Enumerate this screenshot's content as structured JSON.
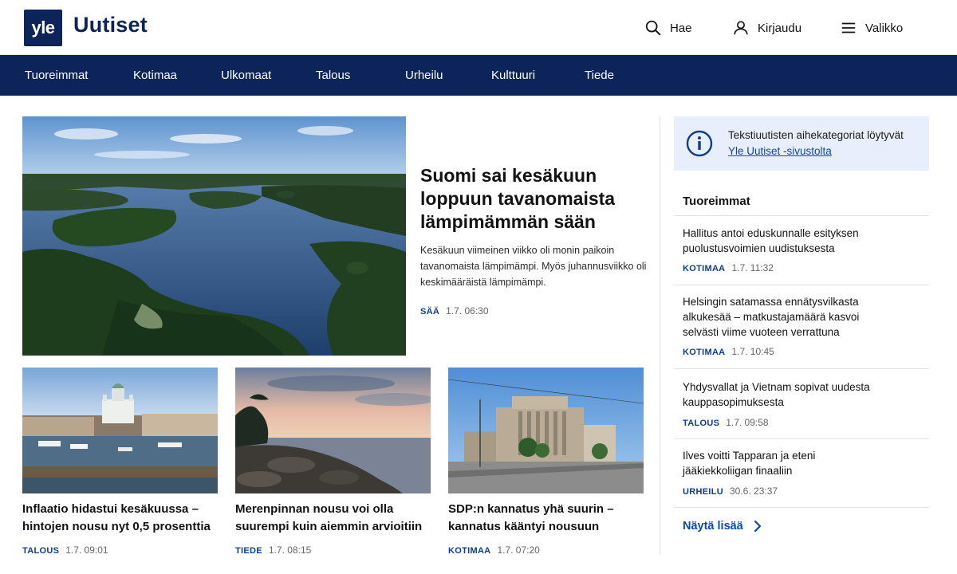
{
  "header": {
    "logo_text": "yle",
    "brand": "Uutiset",
    "search_label": "Hae",
    "login_label": "Kirjaudu",
    "menu_label": "Valikko"
  },
  "nav": {
    "items": [
      "Tuoreimmat",
      "Kotimaa",
      "Ulkomaat",
      "Talous",
      "Urheilu",
      "Kulttuuri",
      "Tiede"
    ]
  },
  "hero": {
    "title": "Suomi sai kesäkuun loppuun tavanomaista lämpimämmän sään",
    "lead": "Kesäkuun viimeinen viikko oli monin paikoin tavanomaista lämpimämpi. Myös juhannusviikko oli keskimääräistä lämpimämpi.",
    "category": "SÄÄ",
    "time": "1.7. 06:30",
    "image": "lake-forest-aerial"
  },
  "cards": [
    {
      "title": "Inflaatio hidastui kesäkuussa – hintojen nousu nyt 0,5 prosenttia",
      "category": "TALOUS",
      "time": "1.7. 09:01",
      "image": "helsinki-harbor"
    },
    {
      "title": "Merenpinnan nousu voi olla suurempi kuin aiemmin arvioitiin",
      "category": "TIEDE",
      "time": "1.7. 08:15",
      "image": "rocky-shore-sunset"
    },
    {
      "title": "SDP:n kannatus yhä suurin – kannatus kääntyi nousuun",
      "category": "KOTIMAA",
      "time": "1.7. 07:20",
      "image": "parliament-building"
    }
  ],
  "notice": {
    "text": "Tekstiuutisten aihekategoriat löytyvät ",
    "link": "Yle Uutiset -sivustolta",
    "icon": "info-icon"
  },
  "sidebar": {
    "heading": "Tuoreimmat",
    "items": [
      {
        "title": "Hallitus antoi eduskunnalle esityksen puolustusvoimien uudistuksesta",
        "category": "KOTIMAA",
        "time": "1.7. 11:32"
      },
      {
        "title": "Helsingin satamassa ennätysvilkasta alkukesää – matkustajamäärä kasvoi selvästi viime vuoteen verrattuna",
        "category": "KOTIMAA",
        "time": "1.7. 10:45"
      },
      {
        "title": "Yhdysvallat ja Vietnam sopivat uudesta kauppasopimuksesta",
        "category": "TALOUS",
        "time": "1.7. 09:58"
      },
      {
        "title": "Ilves voitti Tapparan ja eteni jääkiekkoliigan finaaliin",
        "category": "URHEILU",
        "time": "30.6. 23:37"
      }
    ],
    "more_label": "Näytä lisää"
  },
  "colors": {
    "brand_navy": "#0c2459",
    "link_blue": "#0a47b8",
    "notice_bg": "#e8eefb"
  }
}
